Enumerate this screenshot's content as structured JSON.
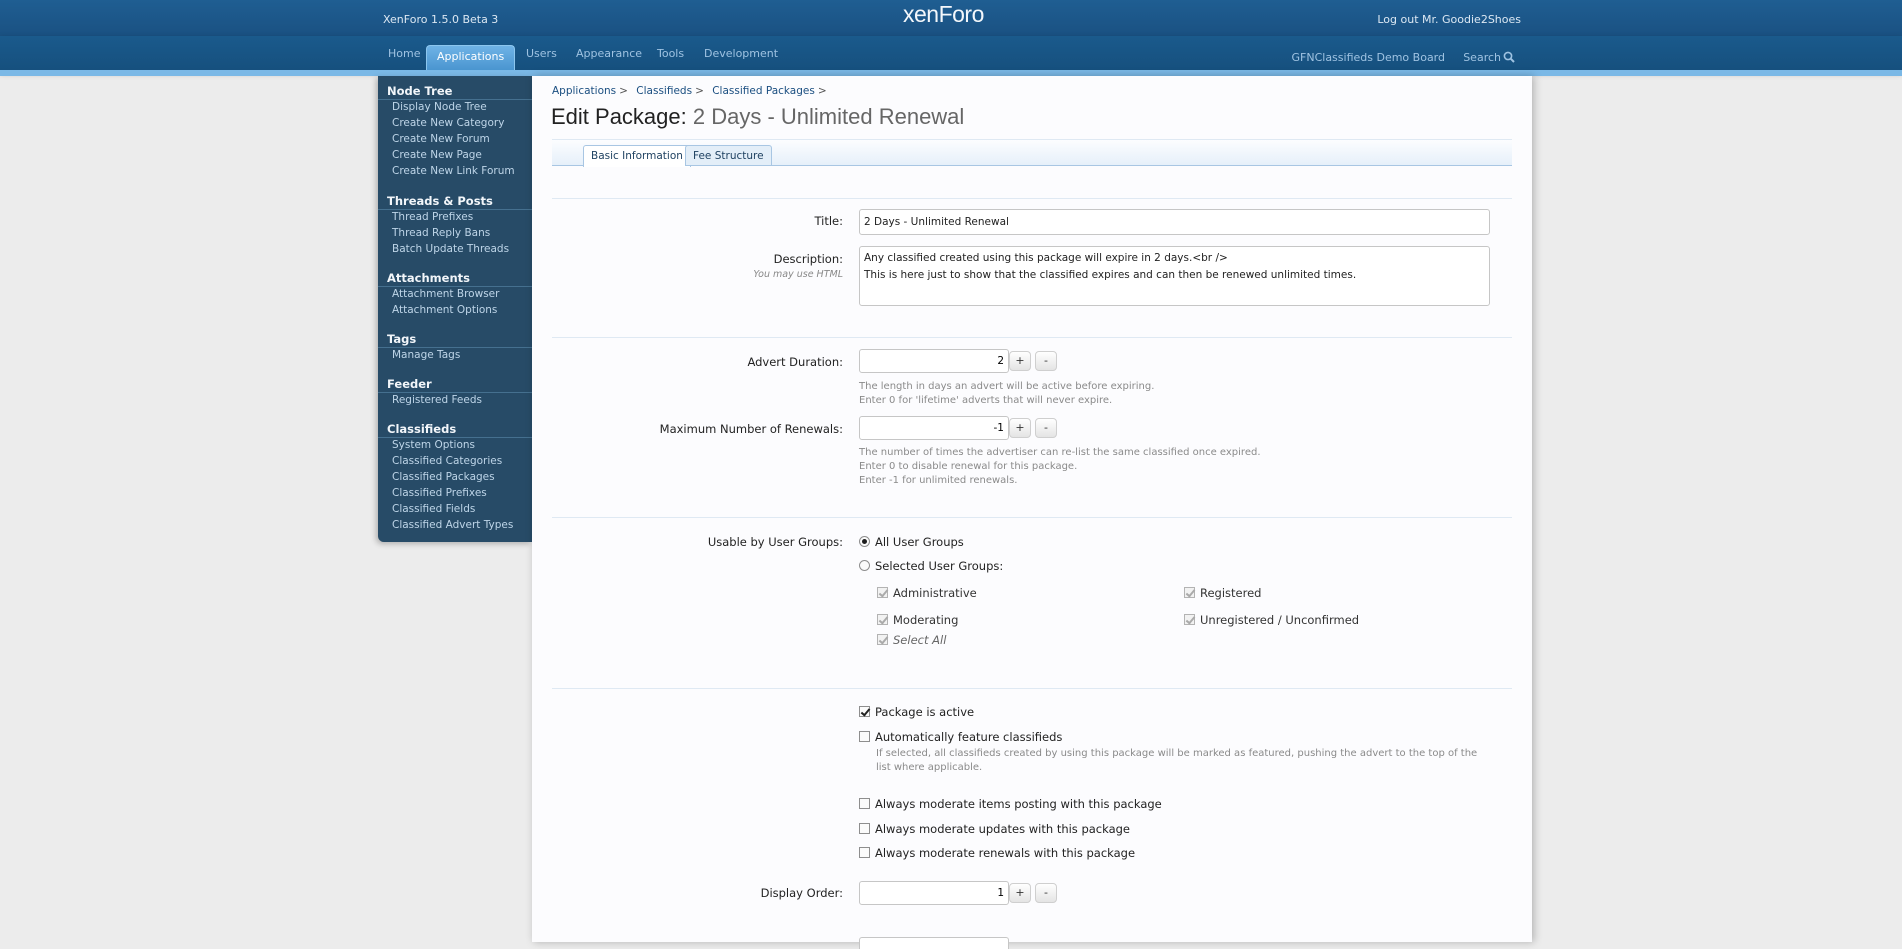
{
  "header": {
    "version": "XenForo 1.5.0 Beta 3",
    "logo_text": "xenForo",
    "logout": "Log out Mr. Goodie2Shoes",
    "board_name": "GFNClassifieds Demo Board",
    "search_label": "Search"
  },
  "nav": {
    "tabs": [
      "Home",
      "Applications",
      "Users",
      "Appearance",
      "Tools",
      "Development"
    ],
    "active_tab": "Applications"
  },
  "sidebar": {
    "sections": [
      {
        "title": "Node Tree",
        "links": [
          "Display Node Tree",
          "Create New Category",
          "Create New Forum",
          "Create New Page",
          "Create New Link Forum"
        ]
      },
      {
        "title": "Threads & Posts",
        "links": [
          "Thread Prefixes",
          "Thread Reply Bans",
          "Batch Update Threads"
        ]
      },
      {
        "title": "Attachments",
        "links": [
          "Attachment Browser",
          "Attachment Options"
        ]
      },
      {
        "title": "Tags",
        "links": [
          "Manage Tags"
        ]
      },
      {
        "title": "Feeder",
        "links": [
          "Registered Feeds"
        ]
      },
      {
        "title": "Classifieds",
        "links": [
          "System Options",
          "Classified Categories",
          "Classified Packages",
          "Classified Prefixes",
          "Classified Fields",
          "Classified Advert Types"
        ]
      }
    ]
  },
  "breadcrumb": [
    "Applications",
    "Classifieds",
    "Classified Packages"
  ],
  "page": {
    "title_prefix": "Edit Package:",
    "title_name": "2 Days - Unlimited Renewal"
  },
  "form_tabs": [
    "Basic Information",
    "Fee Structure"
  ],
  "form": {
    "title_label": "Title:",
    "title_value": "2 Days - Unlimited Renewal",
    "description_label": "Description:",
    "description_hint": "You may use HTML",
    "description_value": "Any classified created using this package will expire in 2 days.<br />\nThis is here just to show that the classified expires and can then be renewed unlimited times.",
    "duration_label": "Advert Duration:",
    "duration_value": "2",
    "duration_explain_1": "The length in days an advert will be active before expiring.",
    "duration_explain_2": "Enter 0 for 'lifetime' adverts that will never expire.",
    "renewals_label": "Maximum Number of Renewals:",
    "renewals_value": "-1",
    "renewals_explain_1": "The number of times the advertiser can re-list the same classified once expired.",
    "renewals_explain_2": "Enter 0 to disable renewal for this package.",
    "renewals_explain_3": "Enter -1 for unlimited renewals.",
    "spin_plus": "+",
    "spin_minus": "-",
    "usergroups_label": "Usable by User Groups:",
    "all_groups": "All User Groups",
    "selected_groups": "Selected User Groups:",
    "groups": [
      "Administrative",
      "Registered",
      "Moderating",
      "Unregistered / Unconfirmed"
    ],
    "select_all": "Select All",
    "active_label": "Package is active",
    "feature_label": "Automatically feature classifieds",
    "feature_explain_1": "If selected, all classifieds created by using this package will be marked as featured, pushing the advert to the top of the",
    "feature_explain_2": "list where applicable.",
    "moderate_posting": "Always moderate items posting with this package",
    "moderate_updates": "Always moderate updates with this package",
    "moderate_renewals": "Always moderate renewals with this package",
    "order_label": "Display Order:",
    "order_value": "1"
  }
}
